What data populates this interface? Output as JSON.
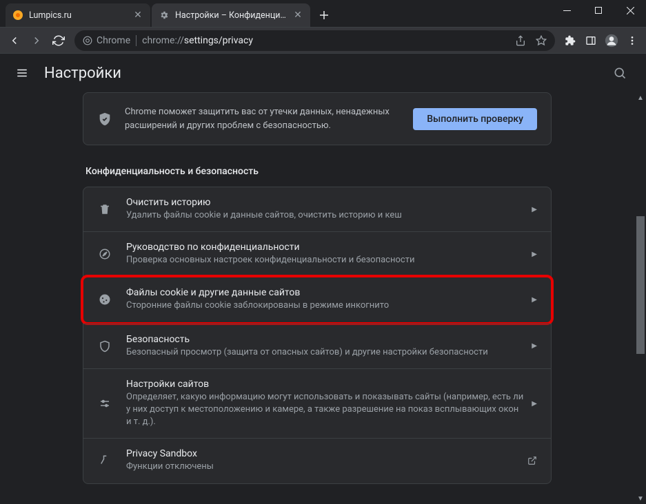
{
  "tabs": [
    {
      "title": "Lumpics.ru"
    },
    {
      "title": "Настройки – Конфиденциально"
    }
  ],
  "omnibox": {
    "chip": "Chrome",
    "url_prefix": "chrome://",
    "url_path": "settings/privacy"
  },
  "header": {
    "title": "Настройки"
  },
  "safety": {
    "text": "Chrome поможет защитить вас от утечки данных, ненадежных расширений и других проблем с безопасностью.",
    "button": "Выполнить проверку"
  },
  "section_heading": "Конфиденциальность и безопасность",
  "rows": [
    {
      "title": "Очистить историю",
      "sub": "Удалить файлы cookie и данные сайтов, очистить историю и кеш"
    },
    {
      "title": "Руководство по конфиденциальности",
      "sub": "Проверка основных настроек конфиденциальности и безопасности"
    },
    {
      "title": "Файлы cookie и другие данные сайтов",
      "sub": "Сторонние файлы cookie заблокированы в режиме инкогнито"
    },
    {
      "title": "Безопасность",
      "sub": "Безопасный просмотр (защита от опасных сайтов) и другие настройки безопасности"
    },
    {
      "title": "Настройки сайтов",
      "sub": "Определяет, какую информацию могут использовать и показывать сайты (например, есть ли у них доступ к местоположению и камере, а также разрешение на показ всплывающих окон и т. д.)."
    },
    {
      "title": "Privacy Sandbox",
      "sub": "Функции отключены"
    }
  ]
}
